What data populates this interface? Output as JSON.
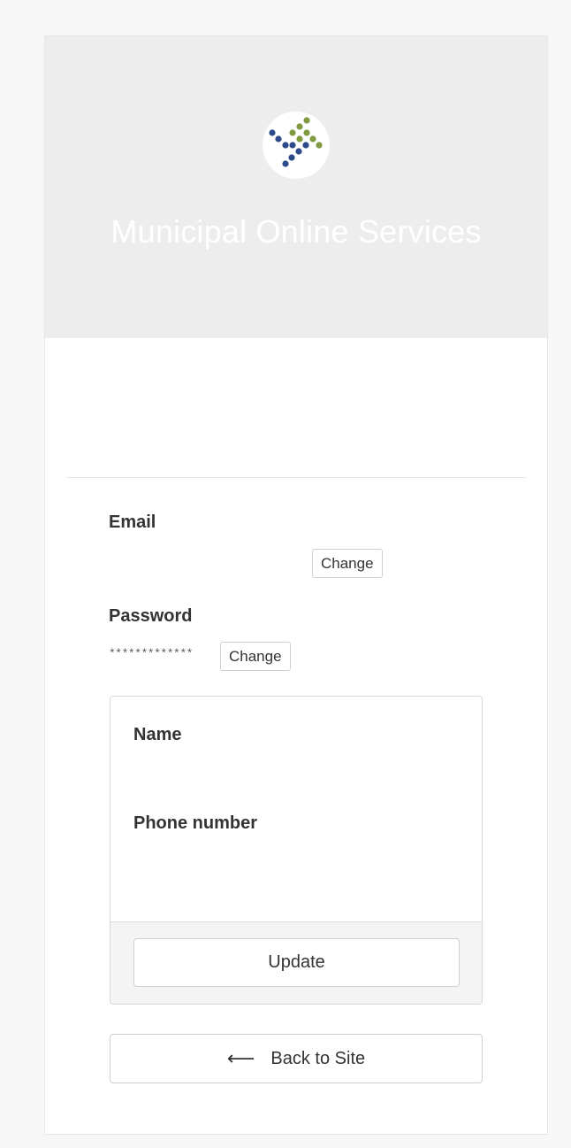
{
  "header": {
    "title": "Municipal Online Services",
    "logo": {
      "icon": "dot-grid-logo-icon",
      "colors": {
        "green": "#7f9a3f",
        "blue": "#2d4a8a"
      }
    }
  },
  "account": {
    "email": {
      "label": "Email",
      "value": "",
      "change_label": "Change"
    },
    "password": {
      "label": "Password",
      "masked": "*************",
      "change_label": "Change"
    }
  },
  "profile_form": {
    "name_label": "Name",
    "phone_label": "Phone number",
    "update_label": "Update"
  },
  "back": {
    "icon": "arrow-left-icon",
    "arrow_glyph": "⟵",
    "label": "Back to Site"
  },
  "colors": {
    "header_bg": "#ededed",
    "page_bg": "#f7f7f7"
  }
}
